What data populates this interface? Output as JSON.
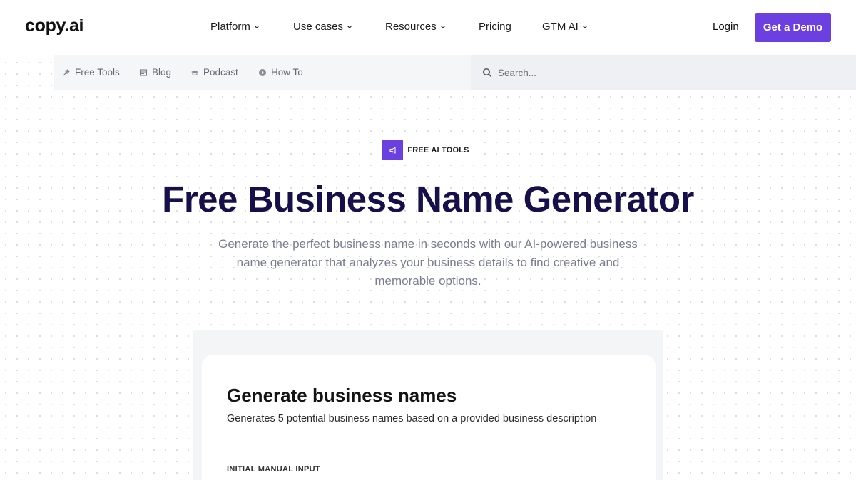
{
  "header": {
    "logo": "copy.ai",
    "nav": [
      {
        "label": "Platform",
        "has_dropdown": true
      },
      {
        "label": "Use cases",
        "has_dropdown": true
      },
      {
        "label": "Resources",
        "has_dropdown": true
      },
      {
        "label": "Pricing",
        "has_dropdown": false
      },
      {
        "label": "GTM AI",
        "has_dropdown": true
      }
    ],
    "login_label": "Login",
    "demo_label": "Get a Demo"
  },
  "subnav": {
    "items": [
      {
        "label": "Free Tools",
        "icon": "tools-icon"
      },
      {
        "label": "Blog",
        "icon": "blog-icon"
      },
      {
        "label": "Podcast",
        "icon": "podcast-icon"
      },
      {
        "label": "How To",
        "icon": "howto-icon"
      }
    ],
    "search_placeholder": "Search..."
  },
  "hero": {
    "badge": "FREE AI TOOLS",
    "title": "Free Business Name Generator",
    "subtitle": "Generate the perfect business name in seconds with our AI-powered business name generator that analyzes your business details to find creative and memorable options."
  },
  "tool_card": {
    "title": "Generate business names",
    "description": "Generates 5 potential business names based on a provided business description",
    "input_label": "INITIAL MANUAL INPUT"
  },
  "colors": {
    "accent": "#6b3fe0",
    "title": "#160f4a",
    "subtitle": "#7a7d92"
  }
}
